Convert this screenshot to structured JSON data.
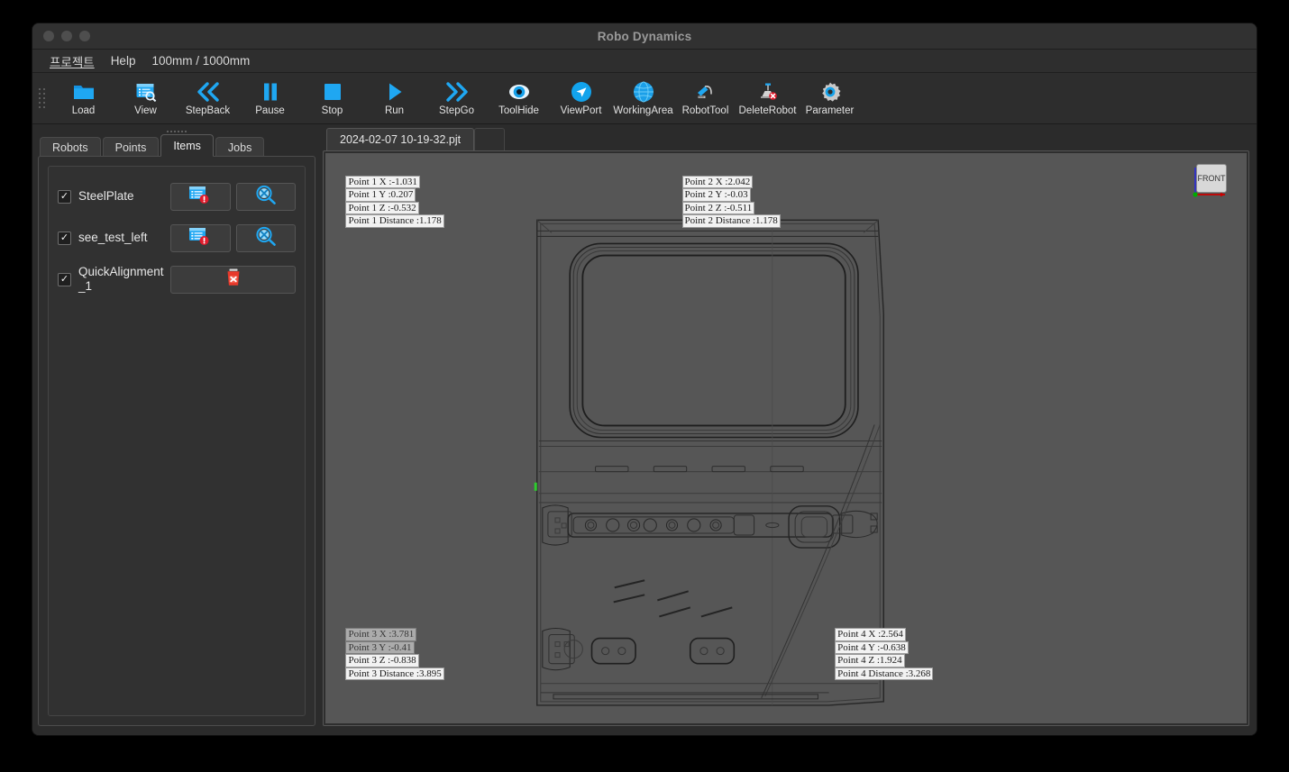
{
  "window": {
    "title": "Robo Dynamics",
    "controls": [
      "close",
      "minimize",
      "maximize"
    ]
  },
  "menubar": {
    "items": [
      {
        "label": "프로젝트",
        "name": "menu-project"
      },
      {
        "label": "Help",
        "name": "menu-help"
      },
      {
        "label": "100mm / 1000mm",
        "name": "menu-grid-scale"
      }
    ]
  },
  "toolbar": {
    "buttons": [
      {
        "label": "Load",
        "icon": "folder-icon"
      },
      {
        "label": "View",
        "icon": "window-search-icon"
      },
      {
        "label": "StepBack",
        "icon": "double-chevron-left-icon"
      },
      {
        "label": "Pause",
        "icon": "pause-icon"
      },
      {
        "label": "Stop",
        "icon": "stop-square-icon"
      },
      {
        "label": "Run",
        "icon": "play-icon"
      },
      {
        "label": "StepGo",
        "icon": "double-chevron-right-icon"
      },
      {
        "label": "ToolHide",
        "icon": "eye-icon"
      },
      {
        "label": "ViewPort",
        "icon": "navigation-arrow-icon"
      },
      {
        "label": "WorkingArea",
        "icon": "globe-icon"
      },
      {
        "label": "RobotTool",
        "icon": "robot-tool-icon"
      },
      {
        "label": "DeleteRobot",
        "icon": "delete-robot-icon"
      },
      {
        "label": "Parameter",
        "icon": "gear-icon"
      }
    ]
  },
  "sidebar": {
    "tabs": [
      {
        "label": "Robots",
        "active": false
      },
      {
        "label": "Points",
        "active": false
      },
      {
        "label": "Items",
        "active": true
      },
      {
        "label": "Jobs",
        "active": false
      }
    ],
    "items": [
      {
        "name": "SteelPlate",
        "checked": "✓",
        "buttons": [
          {
            "icon": "properties-alert-icon"
          },
          {
            "icon": "magnifier-target-icon"
          }
        ]
      },
      {
        "name": "see_test_left",
        "checked": "✓",
        "buttons": [
          {
            "icon": "properties-alert-icon"
          },
          {
            "icon": "magnifier-target-icon"
          }
        ]
      },
      {
        "name": "QuickAlignment_1",
        "checked": "✓",
        "buttons": [
          {
            "icon": "delete-trash-icon"
          }
        ]
      }
    ]
  },
  "document": {
    "tab_label": "2024-02-07 10-19-32.pjt"
  },
  "viewport": {
    "background_color": "#565656",
    "view_cube_label": "FRONT",
    "axis_colors": {
      "x": "#cc0000",
      "y": "#00aa00",
      "z": "#3030cc"
    },
    "point_labels": [
      {
        "id": "point-1",
        "lines": [
          "Point 1 X :-1.031",
          "Point 1 Y :0.207",
          "Point 1 Z :-0.532",
          "Point 1 Distance :1.178"
        ]
      },
      {
        "id": "point-2",
        "lines": [
          "Point 2 X :2.042",
          "Point 2 Y :-0.03",
          "Point 2 Z :-0.511",
          "Point 2 Distance :1.178"
        ]
      },
      {
        "id": "point-3",
        "lines": [
          "Point 3 X :3.781",
          "Point 3 Y :-0.41",
          "Point 3 Z :-0.838",
          "Point 3 Distance :3.895"
        ]
      },
      {
        "id": "point-4",
        "lines": [
          "Point 4 X :2.564",
          "Point 4 Y :-0.638",
          "Point 4 Z :1.924",
          "Point 4 Distance :3.268"
        ]
      }
    ]
  }
}
